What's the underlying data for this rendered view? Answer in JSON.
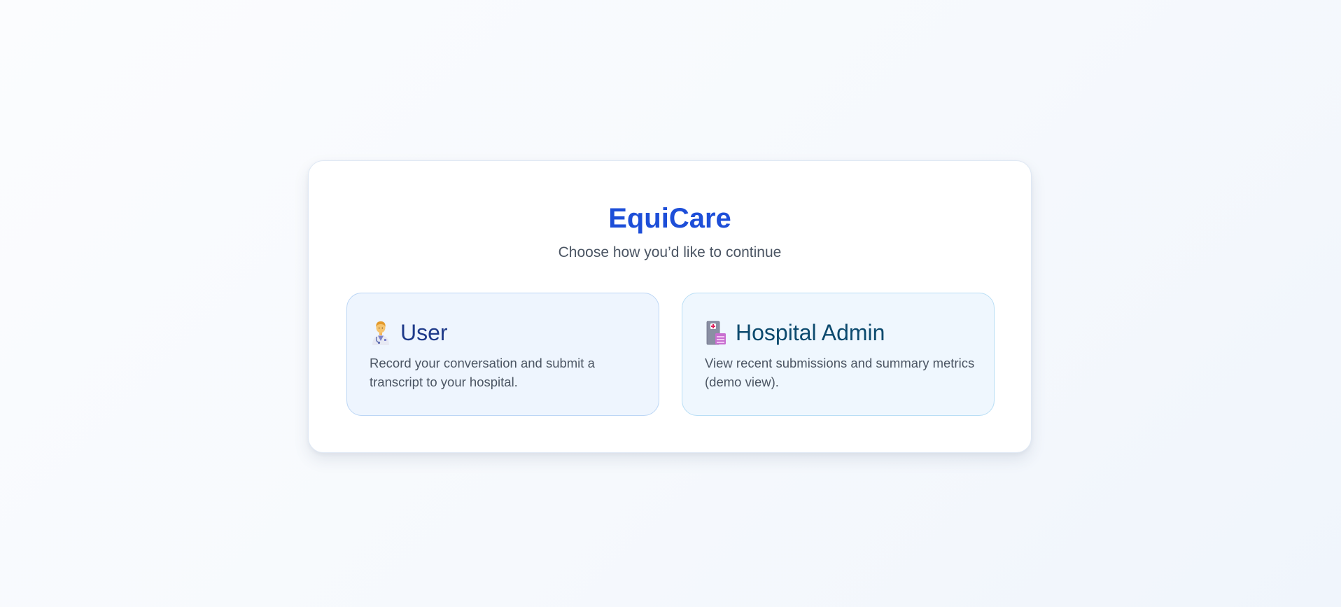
{
  "app": {
    "title": "EquiCare",
    "subtitle": "Choose how you’d like to continue"
  },
  "options": [
    {
      "label": "User",
      "icon": "doctor-icon",
      "description": "Record your conversation and submit a transcript to your hospital."
    },
    {
      "label": "Hospital Admin",
      "icon": "hospital-icon",
      "description": "View recent submissions and summary metrics (demo view)."
    }
  ],
  "colors": {
    "accent": "#1d4ed8",
    "user_card_bg": "#eef5fe",
    "admin_card_bg": "#eff7fe"
  }
}
